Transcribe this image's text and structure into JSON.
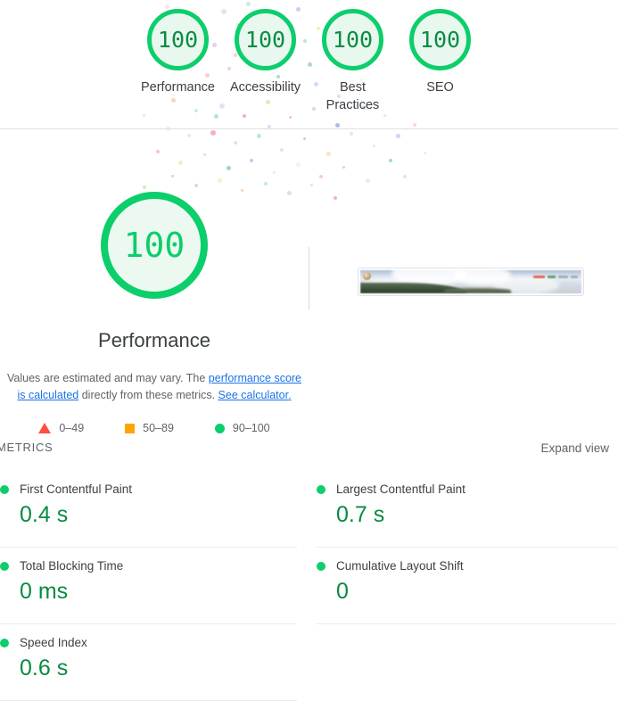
{
  "category_scores": [
    {
      "score": "100",
      "label": "Performance",
      "color": "#0cce6b"
    },
    {
      "score": "100",
      "label": "Accessibility",
      "color": "#0cce6b"
    },
    {
      "score": "100",
      "label": "Best\nPractices",
      "color": "#0cce6b"
    },
    {
      "score": "100",
      "label": "SEO",
      "color": "#0cce6b"
    }
  ],
  "category_labels": {
    "performance": "Performance",
    "accessibility": "Accessibility",
    "best_practices_line1": "Best",
    "best_practices_line2": "Practices",
    "seo": "SEO"
  },
  "performance_panel": {
    "score": "100",
    "title": "Performance",
    "disclaimer_prefix": "Values are estimated and may vary. The ",
    "disclaimer_link1": "performance score is calculated",
    "disclaimer_middle": " directly from these metrics. ",
    "disclaimer_link2": "See calculator.",
    "legend": [
      {
        "marker": "triangle-marker",
        "range": "0–49",
        "color": "#ff4e42"
      },
      {
        "marker": "square-marker",
        "range": "50–89",
        "color": "#ffa400"
      },
      {
        "marker": "circle-marker",
        "range": "90–100",
        "color": "#0cce6b"
      }
    ]
  },
  "filmstrip": {
    "alt": "final-page-screenshot-thumbnail"
  },
  "metrics_section": {
    "title": "METRICS",
    "expand_view_label": "Expand view",
    "left_column": [
      {
        "name": "First Contentful Paint",
        "value": "0.4 s",
        "status_color": "#0cce6b"
      },
      {
        "name": "Total Blocking Time",
        "value": "0 ms",
        "status_color": "#0cce6b"
      },
      {
        "name": "Speed Index",
        "value": "0.6 s",
        "status_color": "#0cce6b"
      }
    ],
    "right_column": [
      {
        "name": "Largest Contentful Paint",
        "value": "0.7 s",
        "status_color": "#0cce6b"
      },
      {
        "name": "Cumulative Layout Shift",
        "value": "0",
        "status_color": "#0cce6b"
      }
    ]
  }
}
